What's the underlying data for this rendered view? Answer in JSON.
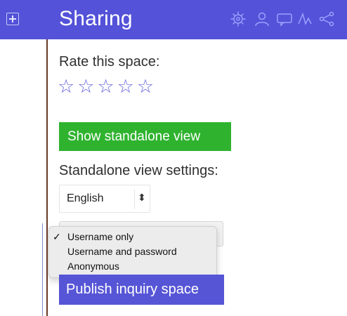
{
  "header": {
    "title": "Sharing",
    "tools": [
      "gear-icon",
      "user-icon",
      "chat-icon",
      "activity-icon",
      "share-icon"
    ]
  },
  "rating": {
    "label": "Rate this space:",
    "stars": [
      "☆",
      "☆",
      "☆",
      "☆",
      "☆"
    ]
  },
  "standalone": {
    "button_label": "Show standalone view",
    "settings_label": "Standalone view settings:",
    "language": {
      "selected": "English"
    },
    "access_options": [
      "Username only",
      "Username and password",
      "Anonymous"
    ],
    "access_selected_index": 0,
    "check_mark": "✓"
  },
  "publish": {
    "button_label": "Publish inquiry space"
  },
  "colors": {
    "header": "#5352d8",
    "green": "#2fb32f",
    "blue_button": "#5655d6",
    "star": "#6666dd"
  }
}
